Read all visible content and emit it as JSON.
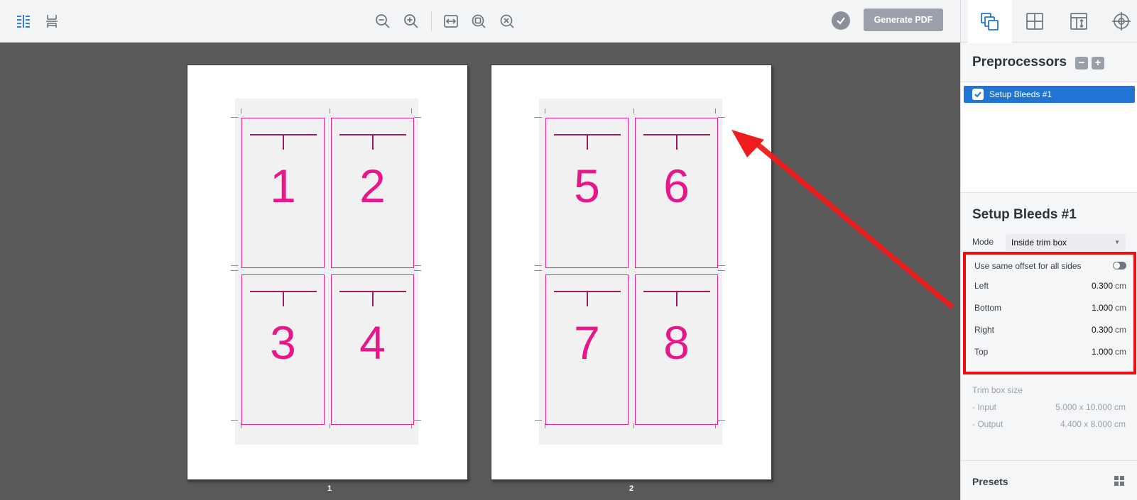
{
  "toolbar": {
    "generate_label": "Generate PDF"
  },
  "pages": [
    {
      "label": "1",
      "cells": [
        "1",
        "2",
        "3",
        "4"
      ]
    },
    {
      "label": "2",
      "cells": [
        "5",
        "6",
        "7",
        "8"
      ]
    }
  ],
  "colors": {
    "accent": "#1f74d4",
    "crop": "#e8208e",
    "highlight": "#f00d12",
    "canvas": "#595959"
  },
  "panel": {
    "preprocessors_title": "Preprocessors",
    "minus_label": "−",
    "plus_label": "+",
    "items": [
      {
        "label": "Setup Bleeds #1",
        "checked": true
      }
    ],
    "setup_title": "Setup Bleeds #1",
    "mode_label": "Mode",
    "mode_value": "Inside trim box",
    "same_offset_label": "Use same offset for all sides",
    "same_offset_on": false,
    "offsets": [
      {
        "label": "Left",
        "value": "0.300",
        "unit": "cm"
      },
      {
        "label": "Bottom",
        "value": "1.000",
        "unit": "cm"
      },
      {
        "label": "Right",
        "value": "0.300",
        "unit": "cm"
      },
      {
        "label": "Top",
        "value": "1.000",
        "unit": "cm"
      }
    ],
    "trim_title": "Trim box size",
    "trim_input_label": "- Input",
    "trim_input_value": "5.000 x 10.000 cm",
    "trim_output_label": "- Output",
    "trim_output_value": "4.400 x 8.000 cm",
    "presets_label": "Presets"
  }
}
